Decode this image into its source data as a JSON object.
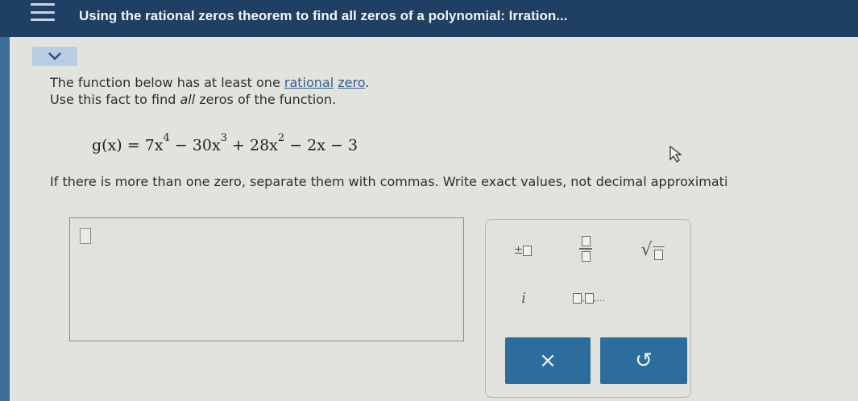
{
  "header": {
    "title": "Using the rational zeros theorem to find all zeros of a polynomial: Irration..."
  },
  "prompt": {
    "line1_pre": "The function below has at least one ",
    "link_rational": "rational",
    "link_zero": "zero",
    "line1_post": ".",
    "line2_pre": "Use this fact to find ",
    "line2_em": "all",
    "line2_post": " zeros of the function."
  },
  "equation": {
    "lhs": "g(x) = 7x",
    "exp1": "4",
    "t2": " − 30x",
    "exp2": "3",
    "t3": " + 28x",
    "exp3": "2",
    "t4": " − 2x − 3"
  },
  "instructions": "If there is more than one zero, separate them with commas. Write exact values, not decimal approximati",
  "keypad": {
    "plus_minus": "±",
    "imaginary": "i",
    "list_dots": ",...",
    "clear_symbol": "×",
    "undo_symbol": "↺"
  }
}
